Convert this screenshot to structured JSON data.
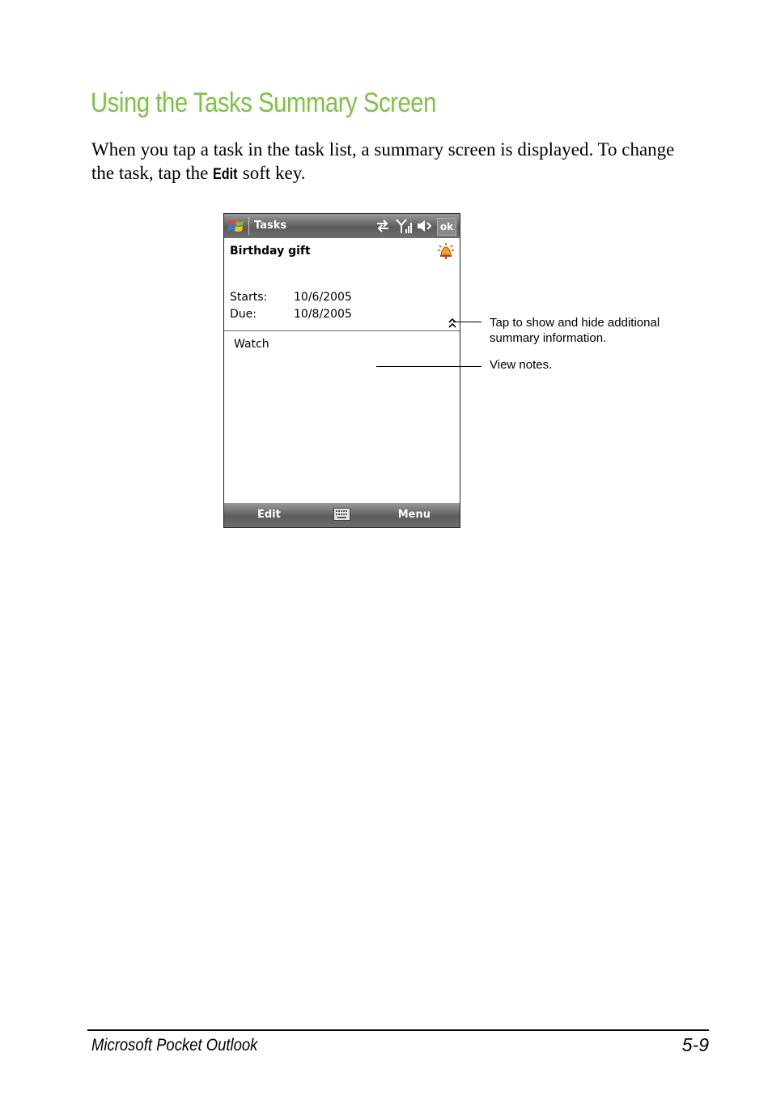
{
  "section": {
    "heading": "Using the Tasks Summary Screen",
    "intro_before": "When you tap a task in the task list, a summary screen is displayed. To change the task, tap the ",
    "intro_keyword": "Edit",
    "intro_after": " soft key."
  },
  "device": {
    "app_title": "Tasks",
    "ok_label": "ok",
    "task_title": "Birthday gift",
    "starts_label": "Starts:",
    "starts_value": "10/6/2005",
    "due_label": "Due:",
    "due_value": "10/8/2005",
    "notes_text": "Watch",
    "softkey_left": "Edit",
    "softkey_right": "Menu",
    "icons": [
      "windows-start-icon",
      "connectivity-icon",
      "signal-icon",
      "volume-icon",
      "alarm-bell-icon",
      "expand-chevron-icon",
      "keyboard-icon"
    ]
  },
  "callouts": {
    "expand": "Tap to show and hide additional summary information.",
    "notes": "View notes."
  },
  "footer": {
    "chapter": "Microsoft Pocket Outlook",
    "page": "5-9"
  },
  "colors": {
    "heading": "#7dc242",
    "bar": "#6e6e6e"
  }
}
